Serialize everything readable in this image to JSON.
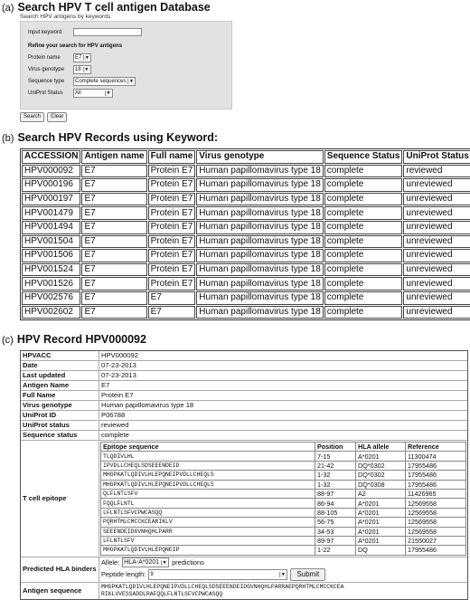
{
  "section_a": {
    "label": "(a)",
    "title": "Search HPV T cell antigen Database",
    "subtitle": "Search HPV antigens by keywords",
    "input_label": "Input keyword",
    "input_value": "",
    "refine_title": "Refine your search for HPV antigens",
    "filters": [
      {
        "label": "Protein name",
        "value": "E7"
      },
      {
        "label": "Virus genotype",
        "value": "18"
      },
      {
        "label": "Sequence type",
        "value": "Complete sequences"
      },
      {
        "label": "UniProt Status",
        "value": "All"
      }
    ],
    "search_button": "Search",
    "clear_button": "Clear"
  },
  "section_b": {
    "label": "(b)",
    "title": "Search HPV Records using Keyword:",
    "columns": [
      "ACCESSION",
      "Antigen name",
      "Full name",
      "Virus genotype",
      "Sequence Status",
      "UniProt Status"
    ],
    "rows": [
      [
        "HPV000092",
        "E7",
        "Protein E7",
        "Human papillomavirus type 18",
        "complete",
        "reviewed"
      ],
      [
        "HPV000196",
        "E7",
        "Protein E7",
        "Human papillomavirus type 18",
        "complete",
        "unreviewed"
      ],
      [
        "HPV000197",
        "E7",
        "Protein E7",
        "Human papillomavirus type 18",
        "complete",
        "unreviewed"
      ],
      [
        "HPV001479",
        "E7",
        "Protein E7",
        "Human papillomavirus type 18",
        "complete",
        "unreviewed"
      ],
      [
        "HPV001494",
        "E7",
        "Protein E7",
        "Human papillomavirus type 18",
        "complete",
        "unreviewed"
      ],
      [
        "HPV001504",
        "E7",
        "Protein E7",
        "Human papillomavirus type 18",
        "complete",
        "unreviewed"
      ],
      [
        "HPV001506",
        "E7",
        "Protein E7",
        "Human papillomavirus type 18",
        "complete",
        "unreviewed"
      ],
      [
        "HPV001524",
        "E7",
        "Protein E7",
        "Human papillomavirus type 18",
        "complete",
        "unreviewed"
      ],
      [
        "HPV001526",
        "E7",
        "Protein E7",
        "Human papillomavirus type 18",
        "complete",
        "unreviewed"
      ],
      [
        "HPV002576",
        "E7",
        "E7",
        "Human papillomavirus type 18",
        "complete",
        "unreviewed"
      ],
      [
        "HPV002602",
        "E7",
        "E7",
        "Human papillomavirus type 18",
        "complete",
        "unreviewed"
      ]
    ]
  },
  "section_c": {
    "label": "(c)",
    "title": "HPV Record HPV000092",
    "fields": [
      {
        "key": "HPVACC",
        "value": "HPV000092"
      },
      {
        "key": "Date",
        "value": "07-23-2013"
      },
      {
        "key": "Last updated",
        "value": "07-23-2013"
      },
      {
        "key": "Antigen Name",
        "value": "E7"
      },
      {
        "key": "Full Name",
        "value": "Protein E7"
      },
      {
        "key": "Virus genotype",
        "value": "Human papillomavirus type 18"
      },
      {
        "key": "UniProt ID",
        "value": "P06788"
      },
      {
        "key": "UniProt status",
        "value": "reviewed"
      },
      {
        "key": "Sequence status",
        "value": "complete"
      }
    ],
    "epitope_label": "T cell epitope",
    "epitope_columns": [
      "Epitope sequence",
      "Position",
      "HLA allele",
      "Reference"
    ],
    "epitopes": [
      [
        "TLQDIVLHL",
        "7-15",
        "A*0201",
        "11300474"
      ],
      [
        "IPVDLLCHEQLSDSEEENDEID",
        "21-42",
        "DQ*0302",
        "17955486"
      ],
      [
        "MHGPKATLQDIVLHLEPQNEIPVDLLCHEQLS",
        "1-32",
        "DQ*0302",
        "17955486"
      ],
      [
        "MHGPKATLQDIVLHLEPQNEIPVDLLCHEQLS",
        "1-32",
        "DQ*0308",
        "17955486"
      ],
      [
        "QLFLNTLSFV",
        "88-97",
        "A2",
        "11426965"
      ],
      [
        "FQQLFLNTL",
        "86-94",
        "A*0201",
        "12569558"
      ],
      [
        "LFLNTLSFVCPWCASQQ",
        "88-105",
        "A*0201",
        "12569558"
      ],
      [
        "PQRHTMLCMCCKCEARIKLV",
        "56-75",
        "A*0201",
        "12569558"
      ],
      [
        "SEEENDEIDGVNHQHLPARR",
        "34-53",
        "A*0201",
        "12569558"
      ],
      [
        "LFLNTLSFV",
        "89-97",
        "A*0201",
        "21550027"
      ],
      [
        "MHGPKATLQDIVLHLEPQNEIP",
        "1-22",
        "DQ",
        "17955486"
      ]
    ],
    "binders_label": "Predicted HLA binders",
    "allele_label": "Allele:",
    "allele_value": "HLA-A*0201",
    "predictions_label": "predictions",
    "peptide_label": "Peptide length:",
    "peptide_value": "9",
    "submit_button": "Submit",
    "sequence_label": "Antigen sequence",
    "sequence_line1": "MHGPKATLQDIVLHLEPQNEIPVDLLCHEQLSDSEEENDEIDGVNHQHLPARRAEPQRHTMLCMCCKCEA",
    "sequence_line2": "RIKLVVESSADDLRAFQQLFLNTLSFVCPWCASQQ"
  }
}
